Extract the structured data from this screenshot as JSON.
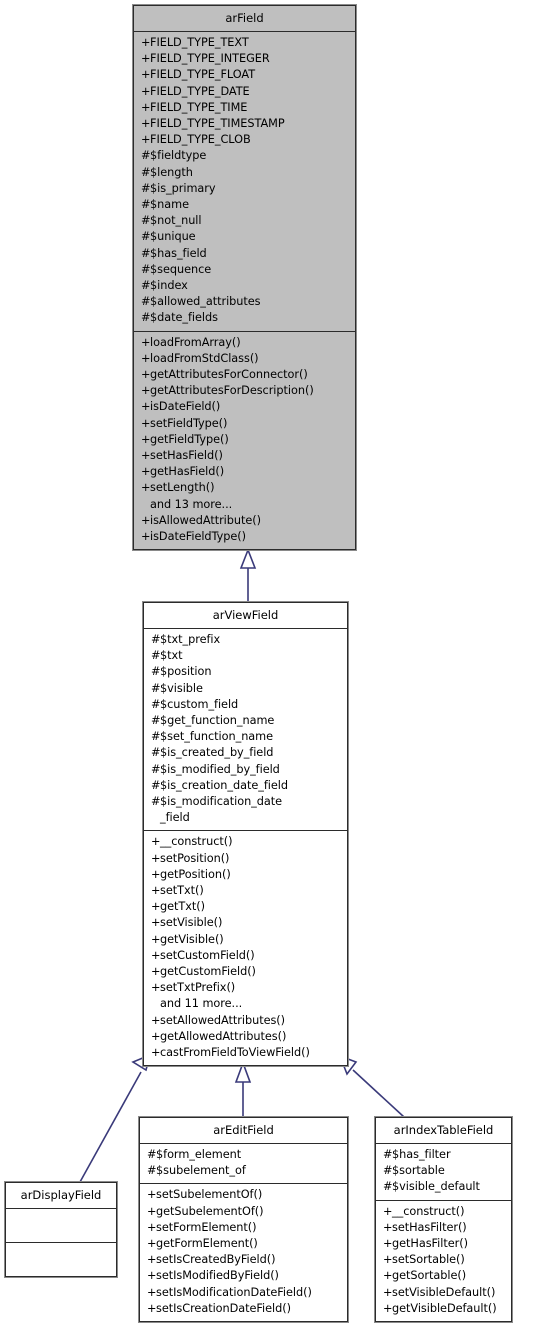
{
  "diagram": {
    "type": "uml-class-inheritance",
    "title_visible": false,
    "colors": {
      "base_class_fill": "#bfbfbf",
      "derived_class_fill": "#ffffff",
      "border": "#2b2b2b",
      "edge": "#3a3a7a",
      "text": "#000000"
    }
  },
  "classes": {
    "arField": {
      "name": "arField",
      "filled": true,
      "attributes": [
        {
          "visibility": "+",
          "label": "FIELD_TYPE_TEXT"
        },
        {
          "visibility": "+",
          "label": "FIELD_TYPE_INTEGER"
        },
        {
          "visibility": "+",
          "label": "FIELD_TYPE_FLOAT"
        },
        {
          "visibility": "+",
          "label": "FIELD_TYPE_DATE"
        },
        {
          "visibility": "+",
          "label": "FIELD_TYPE_TIME"
        },
        {
          "visibility": "+",
          "label": "FIELD_TYPE_TIMESTAMP"
        },
        {
          "visibility": "+",
          "label": "FIELD_TYPE_CLOB"
        },
        {
          "visibility": "#",
          "label": "$fieldtype"
        },
        {
          "visibility": "#",
          "label": "$length"
        },
        {
          "visibility": "#",
          "label": "$is_primary"
        },
        {
          "visibility": "#",
          "label": "$name"
        },
        {
          "visibility": "#",
          "label": "$not_null"
        },
        {
          "visibility": "#",
          "label": "$unique"
        },
        {
          "visibility": "#",
          "label": "$has_field"
        },
        {
          "visibility": "#",
          "label": "$sequence"
        },
        {
          "visibility": "#",
          "label": "$index"
        },
        {
          "visibility": "#",
          "label": "$allowed_attributes"
        },
        {
          "visibility": "#",
          "label": "$date_fields"
        }
      ],
      "methods": [
        {
          "visibility": "+",
          "label": "loadFromArray()"
        },
        {
          "visibility": "+",
          "label": "loadFromStdClass()"
        },
        {
          "visibility": "+",
          "label": "getAttributesForConnector()"
        },
        {
          "visibility": "+",
          "label": "getAttributesForDescription()"
        },
        {
          "visibility": "+",
          "label": "isDateField()"
        },
        {
          "visibility": "+",
          "label": "setFieldType()"
        },
        {
          "visibility": "+",
          "label": "getFieldType()"
        },
        {
          "visibility": "+",
          "label": "setHasField()"
        },
        {
          "visibility": "+",
          "label": "getHasField()"
        },
        {
          "visibility": "+",
          "label": "setLength()"
        },
        {
          "visibility": "",
          "label": "and 13 more..."
        },
        {
          "visibility": "+",
          "label": "isAllowedAttribute()"
        },
        {
          "visibility": "+",
          "label": "isDateFieldType()"
        }
      ]
    },
    "arViewField": {
      "name": "arViewField",
      "filled": false,
      "attributes": [
        {
          "visibility": "#",
          "label": "$txt_prefix"
        },
        {
          "visibility": "#",
          "label": "$txt"
        },
        {
          "visibility": "#",
          "label": "$position"
        },
        {
          "visibility": "#",
          "label": "$visible"
        },
        {
          "visibility": "#",
          "label": "$custom_field"
        },
        {
          "visibility": "#",
          "label": "$get_function_name"
        },
        {
          "visibility": "#",
          "label": "$set_function_name"
        },
        {
          "visibility": "#",
          "label": "$is_created_by_field"
        },
        {
          "visibility": "#",
          "label": "$is_modified_by_field"
        },
        {
          "visibility": "#",
          "label": "$is_creation_date_field"
        },
        {
          "visibility": "#",
          "label": "$is_modification_date"
        },
        {
          "visibility": "",
          "label": "_field"
        }
      ],
      "methods": [
        {
          "visibility": "+",
          "label": "__construct()"
        },
        {
          "visibility": "+",
          "label": "setPosition()"
        },
        {
          "visibility": "+",
          "label": "getPosition()"
        },
        {
          "visibility": "+",
          "label": "setTxt()"
        },
        {
          "visibility": "+",
          "label": "getTxt()"
        },
        {
          "visibility": "+",
          "label": "setVisible()"
        },
        {
          "visibility": "+",
          "label": "getVisible()"
        },
        {
          "visibility": "+",
          "label": "setCustomField()"
        },
        {
          "visibility": "+",
          "label": "getCustomField()"
        },
        {
          "visibility": "+",
          "label": "setTxtPrefix()"
        },
        {
          "visibility": "",
          "label": "and 11 more..."
        },
        {
          "visibility": "+",
          "label": "setAllowedAttributes()"
        },
        {
          "visibility": "+",
          "label": "getAllowedAttributes()"
        },
        {
          "visibility": "+",
          "label": "castFromFieldToViewField()"
        }
      ]
    },
    "arDisplayField": {
      "name": "arDisplayField",
      "filled": false,
      "attributes": [],
      "methods": []
    },
    "arEditField": {
      "name": "arEditField",
      "filled": false,
      "attributes": [
        {
          "visibility": "#",
          "label": "$form_element"
        },
        {
          "visibility": "#",
          "label": "$subelement_of"
        }
      ],
      "methods": [
        {
          "visibility": "+",
          "label": "setSubelementOf()"
        },
        {
          "visibility": "+",
          "label": "getSubelementOf()"
        },
        {
          "visibility": "+",
          "label": "setFormElement()"
        },
        {
          "visibility": "+",
          "label": "getFormElement()"
        },
        {
          "visibility": "+",
          "label": "setIsCreatedByField()"
        },
        {
          "visibility": "+",
          "label": "setIsModifiedByField()"
        },
        {
          "visibility": "+",
          "label": "setIsModificationDateField()"
        },
        {
          "visibility": "+",
          "label": "setIsCreationDateField()"
        }
      ]
    },
    "arIndexTableField": {
      "name": "arIndexTableField",
      "filled": false,
      "attributes": [
        {
          "visibility": "#",
          "label": "$has_filter"
        },
        {
          "visibility": "#",
          "label": "$sortable"
        },
        {
          "visibility": "#",
          "label": "$visible_default"
        }
      ],
      "methods": [
        {
          "visibility": "+",
          "label": "__construct()"
        },
        {
          "visibility": "+",
          "label": "setHasFilter()"
        },
        {
          "visibility": "+",
          "label": "getHasFilter()"
        },
        {
          "visibility": "+",
          "label": "setSortable()"
        },
        {
          "visibility": "+",
          "label": "getSortable()"
        },
        {
          "visibility": "+",
          "label": "setVisibleDefault()"
        },
        {
          "visibility": "+",
          "label": "getVisibleDefault()"
        }
      ]
    }
  },
  "edges": [
    {
      "from": "arViewField",
      "to": "arField",
      "kind": "generalization"
    },
    {
      "from": "arDisplayField",
      "to": "arViewField",
      "kind": "generalization"
    },
    {
      "from": "arEditField",
      "to": "arViewField",
      "kind": "generalization"
    },
    {
      "from": "arIndexTableField",
      "to": "arViewField",
      "kind": "generalization"
    }
  ]
}
